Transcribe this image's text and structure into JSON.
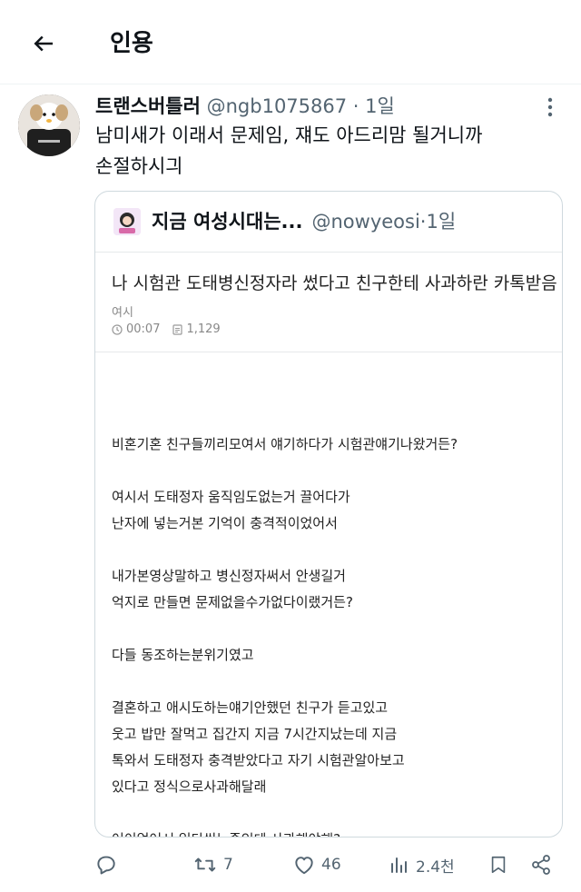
{
  "header": {
    "title": "인용"
  },
  "tweet": {
    "author_name": "트랜스버틀러",
    "author_handle": "@ngb1075867",
    "separator": "·",
    "time": "1일",
    "text_line1": "남미새가 이래서 문제임, 쟤도 아드리맘 될거니까",
    "text_line2": "손절하시긔"
  },
  "quote": {
    "author_name": "지금 여성시대는...",
    "author_handle": "@nowyeosi",
    "separator": "·",
    "time": "1일",
    "post_title": "나 시험관 도태병신정자라 썼다고 친구한테 사과하란 카톡받음",
    "board": "여시",
    "post_time": "00:07",
    "post_views": "1,129",
    "body": [
      "비혼기혼 친구들끼리모여서 얘기하다가 시험관얘기나왔거든?",
      "",
      "여시서 도태정자 움직임도없는거 끌어다가",
      "난자에 넣는거본 기억이 충격적이었어서",
      "",
      "내가본영상말하고 병신정자써서 안생길거",
      "억지로 만들면 문제없을수가없다이랬거든?",
      "",
      "다들 동조하는분위기였고",
      "",
      "결혼하고 애시도하는얘기안했던 친구가 듣고있고",
      "웃고 밥만 잘먹고 집간지 지금 7시간지났는데 지금",
      "톡와서 도태정자 충격받았다고 자기 시험관알아보고",
      "있다고 정식으로사과해달래",
      "",
      "어이없어서 일단씹는중인데 사과해야해?"
    ]
  },
  "actions": {
    "reply_count": "",
    "retweet_count": "7",
    "like_count": "46",
    "view_count": "2.4천"
  },
  "colors": {
    "text_primary": "#0f1419",
    "text_secondary": "#536471",
    "border": "#cfd9de"
  }
}
